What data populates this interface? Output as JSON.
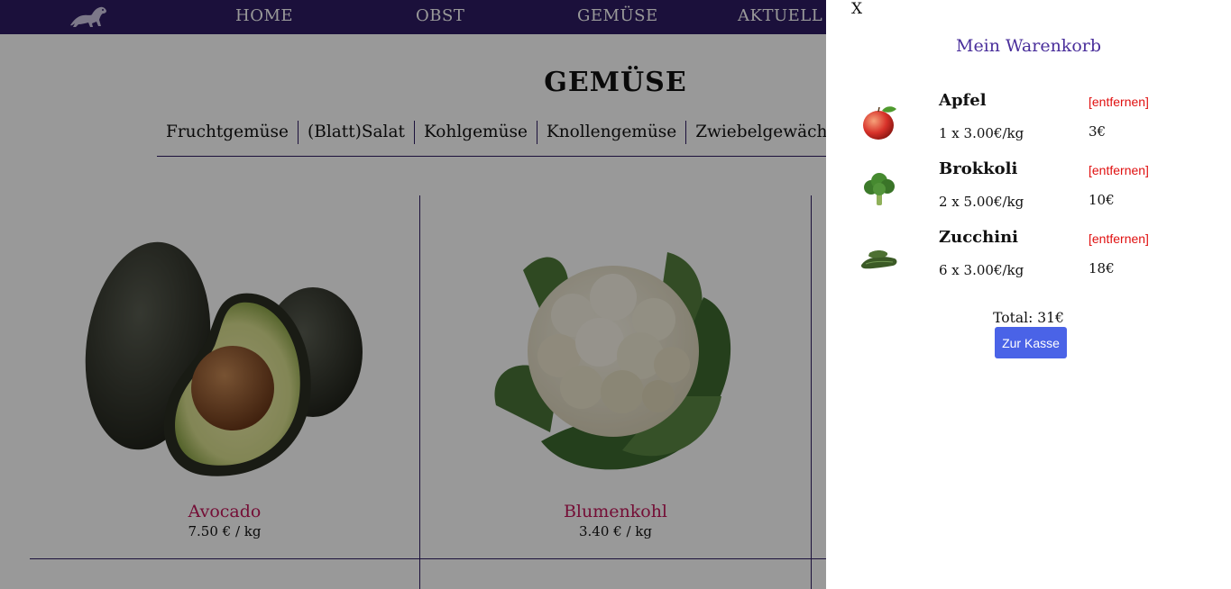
{
  "nav": {
    "logo_icon": "ferret-logo-icon",
    "links": [
      "HOME",
      "OBST",
      "GEMÜSE",
      "AKTUELL"
    ]
  },
  "page": {
    "title": "GEMÜSE",
    "categories": [
      "Fruchtgemüse",
      "(Blatt)Salat",
      "Kohlgemüse",
      "Knollengemüse",
      "Zwiebelgewächse"
    ]
  },
  "products": [
    {
      "name": "Avocado",
      "price": "7.50 € / kg",
      "image_icon": "avocado-image"
    },
    {
      "name": "Blumenkohl",
      "price": "3.40 € / kg",
      "image_icon": "cauliflower-image"
    }
  ],
  "cart": {
    "close_label": "X",
    "title": "Mein Warenkorb",
    "remove_label": "[entfernen]",
    "items": [
      {
        "name": "Apfel",
        "qty": "1 x 3.00€/kg",
        "sum": "3€",
        "icon": "apple-icon"
      },
      {
        "name": "Brokkoli",
        "qty": "2 x 5.00€/kg",
        "sum": "10€",
        "icon": "broccoli-icon"
      },
      {
        "name": "Zucchini",
        "qty": "6 x 3.00€/kg",
        "sum": "18€",
        "icon": "zucchini-icon"
      }
    ],
    "total": "Total: 31€",
    "checkout_label": "Zur Kasse"
  },
  "colors": {
    "nav_bg": "#2d1b63",
    "product_name": "#c2185b",
    "remove_link": "#e01010",
    "checkout_button": "#4a63e7",
    "cart_title": "#4a2f9b"
  }
}
